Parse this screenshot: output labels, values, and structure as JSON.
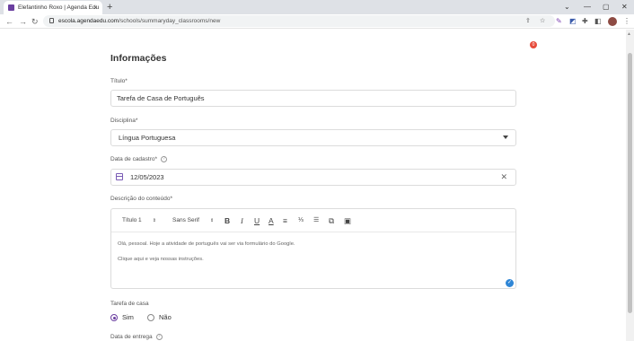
{
  "browser": {
    "tab_title": "Elefantinho Roxo | Agenda Edu",
    "tab_close": "×",
    "new_tab": "+",
    "url_domain": "escola.agendaedu.com",
    "url_path": "/schools/summaryday_classrooms/new",
    "window_controls": {
      "tabs_menu": "⌄",
      "minimize": "—",
      "maximize": "▢",
      "close": "✕"
    },
    "nav": {
      "back": "←",
      "forward": "→",
      "reload": "↻"
    },
    "icons": {
      "share": "⇪",
      "star": "☆",
      "menu": "⋮"
    }
  },
  "page": {
    "notification_count": "0",
    "heading": "Informações",
    "titulo": {
      "label": "Título*",
      "value": "Tarefa de Casa de Português"
    },
    "disciplina": {
      "label": "Disciplina*",
      "value": "Língua Portuguesa"
    },
    "data_cadastro": {
      "label": "Data de cadastro*",
      "value": "12/05/2023",
      "help": "?",
      "clear": "✕"
    },
    "descricao": {
      "label": "Descrição do conteúdo*",
      "heading_select": "Título 1",
      "font_select": "Sans Serif",
      "select_arrow": "⇕",
      "toolbar": {
        "bold": "B",
        "italic": "I",
        "underline": "U",
        "color": "A",
        "align": "≡",
        "ordered_list": "⅓",
        "bullet_list": "☰",
        "link": "⧉",
        "image": "▣"
      },
      "line1": "Olá, pessoal. Hoje a atividade de português vai ser via formulário do Google.",
      "line2": "Clique aqui e veja nossas instruções.",
      "check": "✓"
    },
    "tarefa_casa": {
      "label": "Tarefa de casa",
      "option_yes": "Sim",
      "option_no": "Não",
      "selected": "Sim"
    },
    "data_entrega": {
      "label": "Data de entrega",
      "help": "?"
    }
  },
  "colors": {
    "accent": "#6b3fa0",
    "notification": "#e74c3c",
    "check": "#2f86d6"
  }
}
